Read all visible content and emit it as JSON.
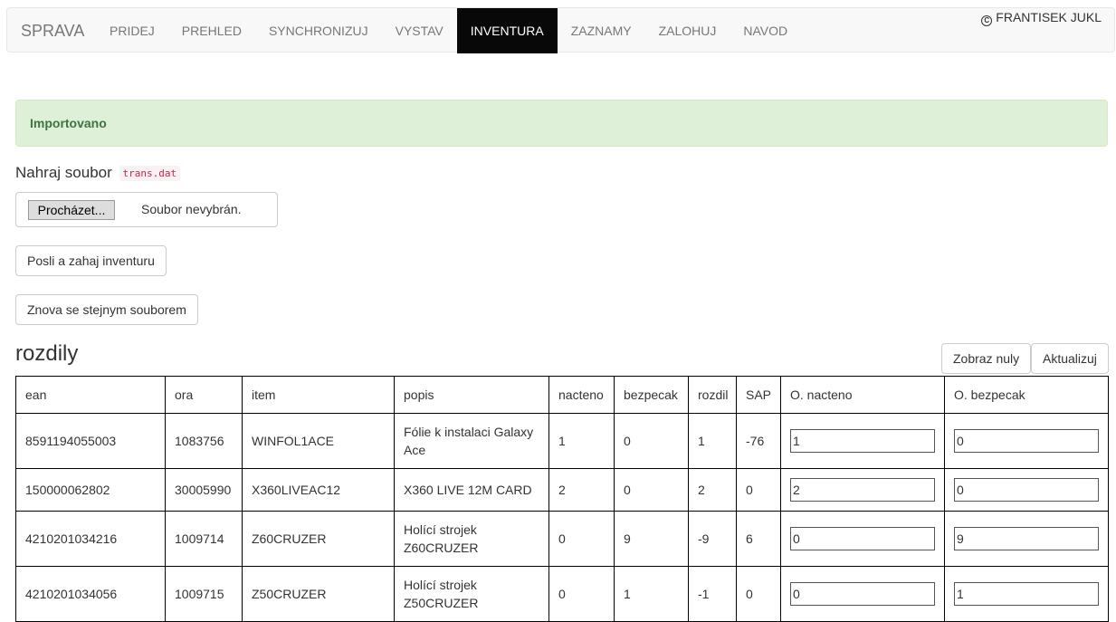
{
  "navbar": {
    "brand": "SPRAVA",
    "items": [
      "PRIDEJ",
      "PREHLED",
      "SYNCHRONIZUJ",
      "VYSTAV",
      "INVENTURA",
      "ZAZNAMY",
      "ZALOHUJ",
      "NAVOD"
    ],
    "active": "INVENTURA",
    "author": "FRANTISEK JUKL",
    "author_icon": "copyright-icon"
  },
  "alert": {
    "text": "Importovano",
    "color": "#3c763d"
  },
  "upload": {
    "label": "Nahraj soubor",
    "filename_code": "trans.dat",
    "browse_label": "Procházet...",
    "file_status": "Soubor nevybrán."
  },
  "buttons": {
    "send": "Posli a zahaj inventuru",
    "again": "Znova se stejnym souborem",
    "show_zeros": "Zobraz nuly",
    "update": "Aktualizuj"
  },
  "section": {
    "title": "rozdily"
  },
  "table": {
    "headers": [
      "ean",
      "ora",
      "item",
      "popis",
      "nacteno",
      "bezpecak",
      "rozdil",
      "SAP",
      "O. nacteno",
      "O. bezpecak"
    ],
    "rows": [
      {
        "ean": "8591194055003",
        "ora": "1083756",
        "item": "WINFOL1ACE",
        "popis": "Fólie k instalaci Galaxy Ace",
        "nacteno": "1",
        "bezpecak": "0",
        "rozdil": "1",
        "sap": "-76",
        "o_nacteno": "1",
        "o_bezpecak": "0"
      },
      {
        "ean": "150000062802",
        "ora": "30005990",
        "item": "X360LIVEAC12",
        "popis": "X360 LIVE 12M CARD",
        "nacteno": "2",
        "bezpecak": "0",
        "rozdil": "2",
        "sap": "0",
        "o_nacteno": "2",
        "o_bezpecak": "0"
      },
      {
        "ean": "4210201034216",
        "ora": "1009714",
        "item": "Z60CRUZER",
        "popis": "Holící strojek Z60CRUZER",
        "nacteno": "0",
        "bezpecak": "9",
        "rozdil": "-9",
        "sap": "6",
        "o_nacteno": "0",
        "o_bezpecak": "9"
      },
      {
        "ean": "4210201034056",
        "ora": "1009715",
        "item": "Z50CRUZER",
        "popis": "Holící strojek Z50CRUZER",
        "nacteno": "0",
        "bezpecak": "1",
        "rozdil": "-1",
        "sap": "0",
        "o_nacteno": "0",
        "o_bezpecak": "1"
      }
    ]
  }
}
